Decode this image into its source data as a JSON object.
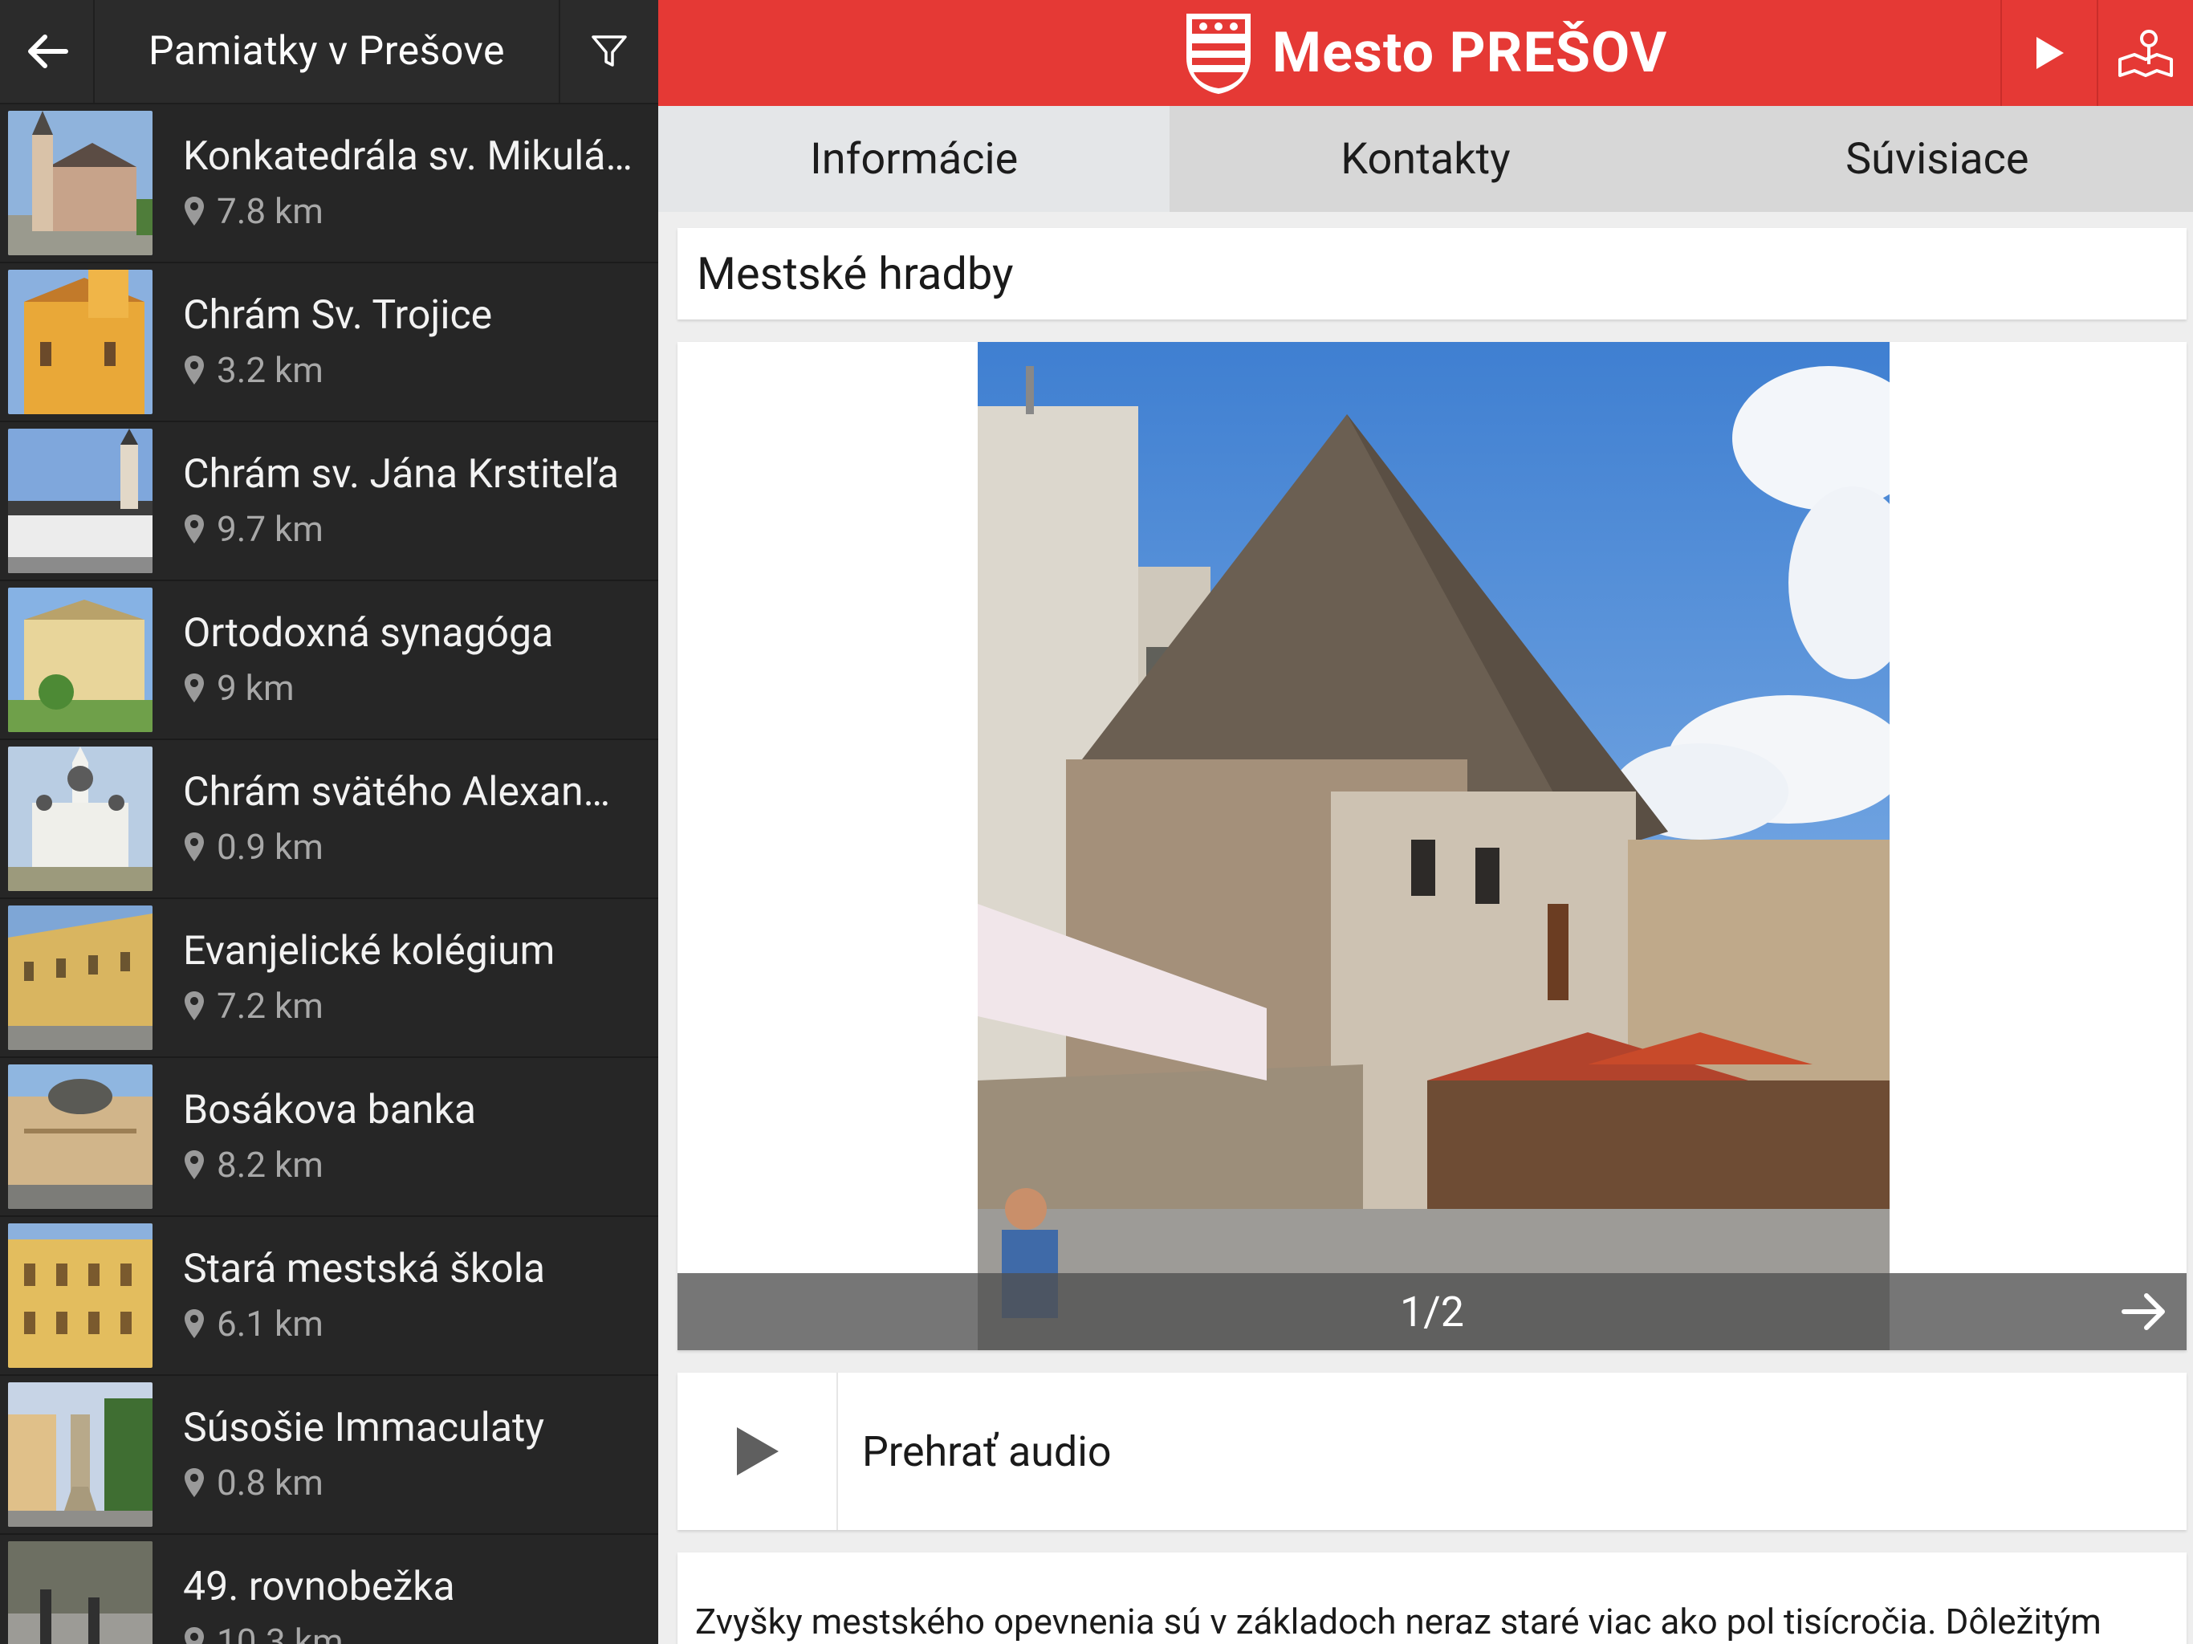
{
  "sidebar": {
    "title": "Pamiatky v Prešove",
    "items": [
      {
        "name": "Konkatedrála sv. Mikuláša",
        "distance": "7.8 km"
      },
      {
        "name": "Chrám Sv. Trojice",
        "distance": "3.2 km"
      },
      {
        "name": "Chrám sv. Jána Krstiteľa",
        "distance": "9.7 km"
      },
      {
        "name": "Ortodoxná synagóga",
        "distance": "9 km"
      },
      {
        "name": "Chrám svätého Alexandra",
        "distance": "0.9 km"
      },
      {
        "name": "Evanjelické kolégium",
        "distance": "7.2 km"
      },
      {
        "name": "Bosákova banka",
        "distance": "8.2 km"
      },
      {
        "name": "Stará mestská škola",
        "distance": "6.1 km"
      },
      {
        "name": "Súsošie Immaculaty",
        "distance": "0.8 km"
      },
      {
        "name": "49. rovnobežka",
        "distance": "10.3 km"
      }
    ]
  },
  "topbar": {
    "brand_title": "Mesto PREŠOV"
  },
  "tabs": [
    {
      "label": "Informácie",
      "active": true
    },
    {
      "label": "Kontakty",
      "active": false
    },
    {
      "label": "Súvisiace",
      "active": false
    }
  ],
  "detail": {
    "title": "Mestské hradby",
    "gallery_counter": "1/2",
    "audio_label": "Prehrať audio",
    "description": "Zvyšky mestského opevnenia sú v základoch neraz staré viac ako pol tisícročia. Dôležitým"
  },
  "colors": {
    "accent": "#e53935",
    "sidebar_bg": "#262626",
    "tab_active": "#e4e6e8",
    "tab_inactive": "#d7d7d7"
  }
}
